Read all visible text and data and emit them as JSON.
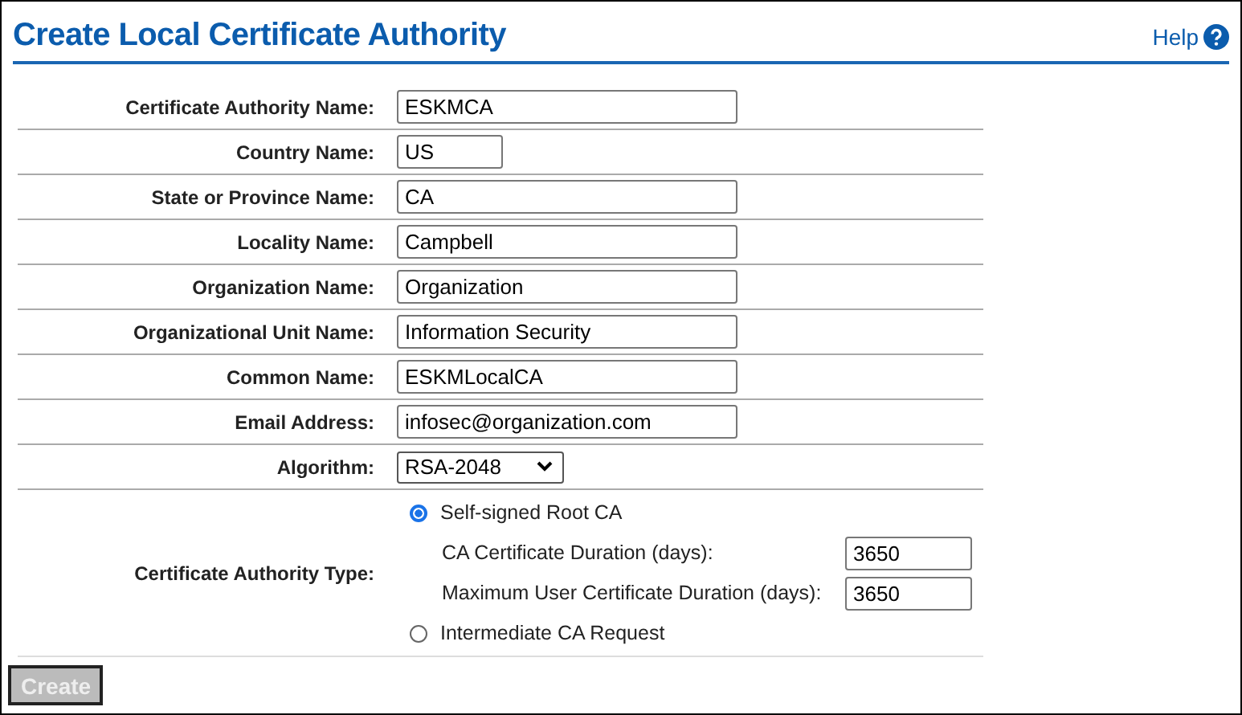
{
  "header": {
    "title": "Create Local Certificate Authority",
    "help": "Help"
  },
  "fields": [
    {
      "label": "Certificate Authority Name:",
      "kind": "text",
      "value": "ESKMCA"
    },
    {
      "label": "Country Name:",
      "kind": "short",
      "value": "US"
    },
    {
      "label": "State or Province Name:",
      "kind": "text",
      "value": "CA"
    },
    {
      "label": "Locality Name:",
      "kind": "text",
      "value": "Campbell"
    },
    {
      "label": "Organization Name:",
      "kind": "text",
      "value": "Organization"
    },
    {
      "label": "Organizational Unit Name:",
      "kind": "text",
      "value": "Information Security"
    },
    {
      "label": "Common Name:",
      "kind": "text",
      "value": "ESKMLocalCA"
    },
    {
      "label": "Email Address:",
      "kind": "text",
      "value": "infosec@organization.com"
    },
    {
      "label": "Algorithm:",
      "kind": "select",
      "value": "RSA-2048"
    }
  ],
  "ca_type": {
    "label": "Certificate Authority Type:",
    "options": [
      {
        "label": "Self-signed Root CA",
        "selected": true,
        "subfields": [
          {
            "label": "CA Certificate Duration (days):",
            "value": "3650"
          },
          {
            "label": "Maximum User Certificate Duration (days):",
            "value": "3650"
          }
        ]
      },
      {
        "label": "Intermediate CA Request",
        "selected": false
      }
    ]
  },
  "create_button": {
    "label": "Create",
    "disabled": true
  }
}
